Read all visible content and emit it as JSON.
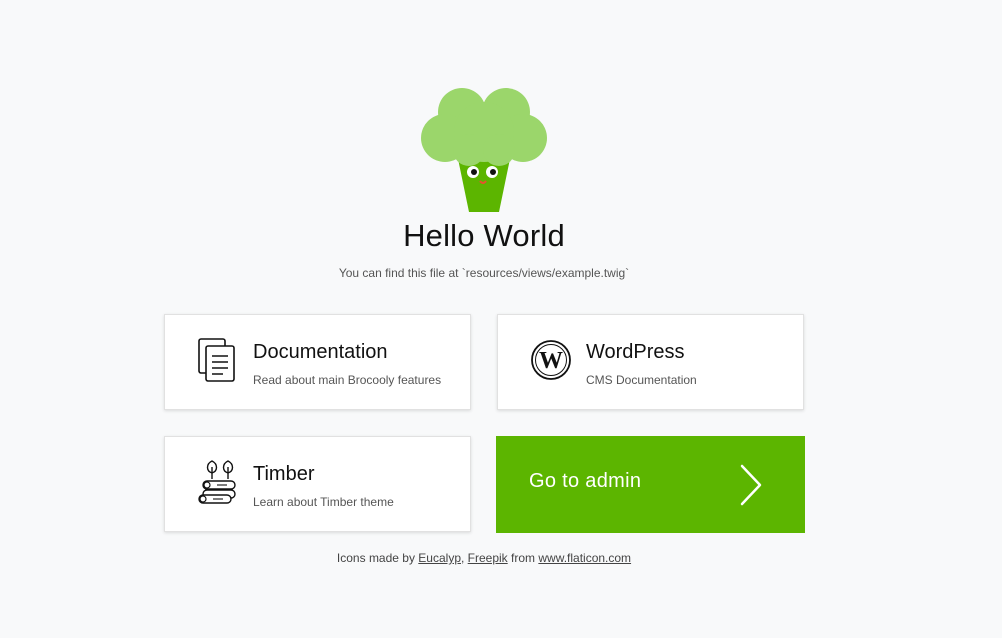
{
  "colors": {
    "background": "#f8f9fa",
    "accent": "#5cb500",
    "mascot_head": "#9bd66b",
    "mascot_stem": "#5cb500"
  },
  "header": {
    "title": "Hello World",
    "subtitle": "You can find this file at `resources/views/example.twig`"
  },
  "cards": {
    "documentation": {
      "icon": "documents-icon",
      "title": "Documentation",
      "description": "Read about main Brocooly features"
    },
    "wordpress": {
      "icon": "wordpress-logo-icon",
      "title": "WordPress",
      "description": "CMS Documentation"
    },
    "timber": {
      "icon": "logs-sprouts-icon",
      "title": "Timber",
      "description": "Learn about Timber theme"
    },
    "admin": {
      "icon": "chevron-right-icon",
      "label": "Go to admin"
    }
  },
  "footer": {
    "prefix": "Icons made by ",
    "link1": "Eucalyp",
    "sep": ", ",
    "link2": "Freepik",
    "middle": " from ",
    "link3": "www.flaticon.com"
  }
}
